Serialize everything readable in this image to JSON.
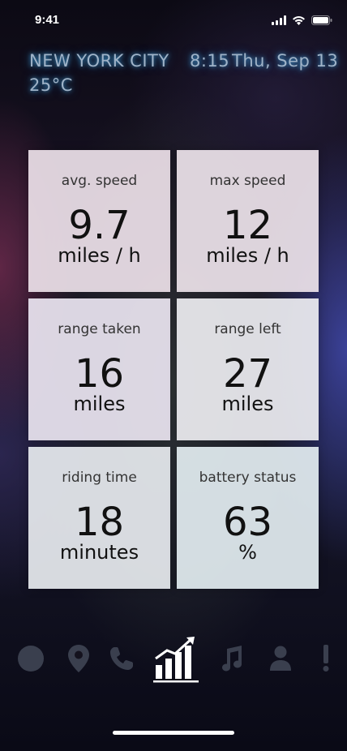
{
  "status_bar": {
    "time": "9:41",
    "icons": [
      "signal-icon",
      "wifi-icon",
      "battery-icon"
    ]
  },
  "header": {
    "city": "NEW YORK CITY",
    "temperature": "25°C",
    "time": "8:15",
    "date": "Thu, Sep 13"
  },
  "stats": [
    {
      "label": "avg. speed",
      "value": "9.7",
      "unit": "miles / h"
    },
    {
      "label": "max speed",
      "value": "12",
      "unit": "miles / h"
    },
    {
      "label": "range taken",
      "value": "16",
      "unit": "miles"
    },
    {
      "label": "range left",
      "value": "27",
      "unit": "miles"
    },
    {
      "label": "riding time",
      "value": "18",
      "unit": "minutes"
    },
    {
      "label": "battery status",
      "value": "63",
      "unit": "%"
    }
  ],
  "nav": {
    "items": [
      "circle-icon",
      "location-pin-icon",
      "phone-icon",
      "stats-chart-icon",
      "music-note-icon",
      "user-icon",
      "alert-icon"
    ],
    "active": "stats-chart-icon"
  },
  "colors": {
    "glow_text": "#9fb3c8",
    "glow": "#46aae6",
    "card_bg": "#ece4ee",
    "inactive_icon": "#3a3f4e",
    "active_icon": "#ffffff"
  }
}
